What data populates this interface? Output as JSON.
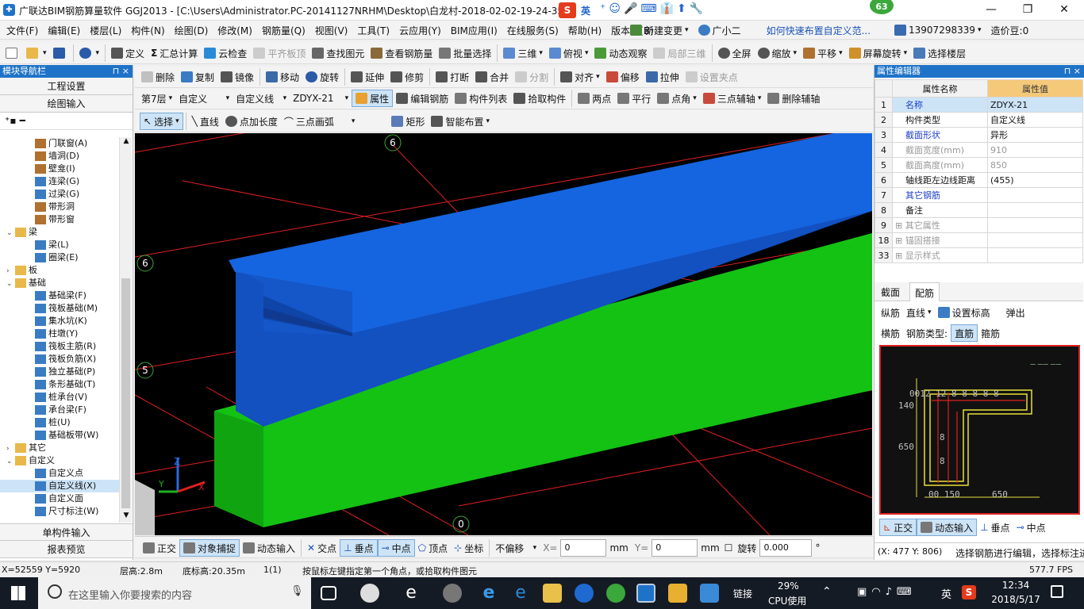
{
  "window": {
    "title": "广联达BIM钢筋算量软件 GGJ2013 - [C:\\Users\\Administrator.PC-20141127NRHM\\Desktop\\白龙村-2018-02-02-19-24-35",
    "badge": "63",
    "ime_lang": "英",
    "minimize": "—",
    "restore": "❐",
    "close": "✕"
  },
  "menu": {
    "items": [
      "文件(F)",
      "编辑(E)",
      "楼层(L)",
      "构件(N)",
      "绘图(D)",
      "修改(M)",
      "钢筋量(Q)",
      "视图(V)",
      "工具(T)",
      "云应用(Y)",
      "BIM应用(I)",
      "在线服务(S)",
      "帮助(H)",
      "版本号(B)"
    ],
    "new_change": "新建变更",
    "assistant": "广小二",
    "help_link": "如何快速布置自定义范...",
    "phone": "13907298339",
    "price": "造价豆:0"
  },
  "toolbar1": {
    "define": "定义",
    "sum_calc": "汇总计算",
    "cloud_check": "云检查",
    "level_top": "平齐板顶",
    "find": "查找图元",
    "view_rebar": "查看钢筋量",
    "batch_select": "批量选择",
    "view3d": "三维",
    "top_view": "俯视",
    "dynamic": "动态观察",
    "local3d": "局部三维",
    "fullscreen": "全屏",
    "zoom": "缩放",
    "pan": "平移",
    "rotate_screen": "屏幕旋转",
    "select_floor": "选择楼层"
  },
  "toolbar2": {
    "delete": "删除",
    "copy": "复制",
    "mirror": "镜像",
    "move": "移动",
    "rotate": "旋转",
    "extend": "延伸",
    "trim": "修剪",
    "break": "打断",
    "merge": "合并",
    "split": "分割",
    "align": "对齐",
    "offset": "偏移",
    "stretch": "拉伸",
    "set_pin": "设置夹点"
  },
  "toolbar3": {
    "floor": "第7层",
    "type": "自定义",
    "subtype": "自定义线",
    "name": "ZDYX-21",
    "properties": "属性",
    "edit_rebar": "编辑钢筋",
    "comp_list": "构件列表",
    "pick": "拾取构件",
    "two_point": "两点",
    "parallel": "平行",
    "point_angle": "点角",
    "three_point_aux": "三点辅轴",
    "delete_aux": "删除辅轴"
  },
  "toolbar4": {
    "select": "选择",
    "line": "直线",
    "point_len": "点加长度",
    "arc": "三点画弧",
    "rect": "矩形",
    "smart": "智能布置"
  },
  "nav": {
    "title": "模块导航栏",
    "pin": "⊓ ×",
    "project": "工程设置",
    "draw_input": "绘图输入",
    "single_input": "单构件输入",
    "report": "报表预览",
    "tree": [
      {
        "t": "门联窗(A)",
        "lvl": 2,
        "c": "#b07030"
      },
      {
        "t": "墙洞(D)",
        "lvl": 2,
        "c": "#b07030"
      },
      {
        "t": "壁龛(I)",
        "lvl": 2,
        "c": "#b07030"
      },
      {
        "t": "连梁(G)",
        "lvl": 2,
        "c": "#3a7cc4"
      },
      {
        "t": "过梁(G)",
        "lvl": 2,
        "c": "#3a7cc4"
      },
      {
        "t": "带形洞",
        "lvl": 2,
        "c": "#b07030"
      },
      {
        "t": "带形窗",
        "lvl": 2,
        "c": "#b07030"
      },
      {
        "t": "梁",
        "lvl": 1,
        "c": "#e8b84a",
        "tog": "⌄"
      },
      {
        "t": "梁(L)",
        "lvl": 2,
        "c": "#3a7cc4"
      },
      {
        "t": "圈梁(E)",
        "lvl": 2,
        "c": "#3a7cc4"
      },
      {
        "t": "板",
        "lvl": 1,
        "c": "#e8b84a",
        "tog": "›"
      },
      {
        "t": "基础",
        "lvl": 1,
        "c": "#e8b84a",
        "tog": "⌄"
      },
      {
        "t": "基础梁(F)",
        "lvl": 2,
        "c": "#3a7cc4"
      },
      {
        "t": "筏板基础(M)",
        "lvl": 2,
        "c": "#3a7cc4"
      },
      {
        "t": "集水坑(K)",
        "lvl": 2,
        "c": "#3a7cc4"
      },
      {
        "t": "柱墩(Y)",
        "lvl": 2,
        "c": "#3a7cc4"
      },
      {
        "t": "筏板主筋(R)",
        "lvl": 2,
        "c": "#3a7cc4"
      },
      {
        "t": "筏板负筋(X)",
        "lvl": 2,
        "c": "#3a7cc4"
      },
      {
        "t": "独立基础(P)",
        "lvl": 2,
        "c": "#3a7cc4"
      },
      {
        "t": "条形基础(T)",
        "lvl": 2,
        "c": "#3a7cc4"
      },
      {
        "t": "桩承台(V)",
        "lvl": 2,
        "c": "#3a7cc4"
      },
      {
        "t": "承台梁(F)",
        "lvl": 2,
        "c": "#3a7cc4"
      },
      {
        "t": "桩(U)",
        "lvl": 2,
        "c": "#3a7cc4"
      },
      {
        "t": "基础板带(W)",
        "lvl": 2,
        "c": "#3a7cc4"
      },
      {
        "t": "其它",
        "lvl": 1,
        "c": "#e8b84a",
        "tog": "›"
      },
      {
        "t": "自定义",
        "lvl": 1,
        "c": "#e8b84a",
        "tog": "⌄"
      },
      {
        "t": "自定义点",
        "lvl": 2,
        "c": "#3a7cc4"
      },
      {
        "t": "自定义线(X)",
        "lvl": 2,
        "c": "#3a7cc4",
        "sel": true
      },
      {
        "t": "自定义面",
        "lvl": 2,
        "c": "#3a7cc4"
      },
      {
        "t": "尺寸标注(W)",
        "lvl": 2,
        "c": "#3a7cc4"
      }
    ]
  },
  "viewport": {
    "axis_labels": [
      "6",
      "6",
      "5",
      "0"
    ],
    "coord_z": "Z",
    "coord_y": "Y",
    "coord_x": "X"
  },
  "snapbar": {
    "ortho": "正交",
    "obj_snap": "对象捕捉",
    "dyn_input": "动态输入",
    "intersect": "交点",
    "perp": "垂点",
    "mid": "中点",
    "vertex": "顶点",
    "coord": "坐标",
    "offset": "不偏移",
    "x_label": "X=",
    "x_val": "0",
    "mm1": "mm",
    "y_label": "Y=",
    "y_val": "0",
    "mm2": "mm",
    "rotate_label": "旋转",
    "rotate_val": "0.000",
    "deg": "°"
  },
  "props": {
    "title": "属性编辑器",
    "col_name": "属性名称",
    "col_val": "属性值",
    "rows": [
      {
        "n": "1",
        "k": "名称",
        "v": "ZDYX-21",
        "kc": "blue"
      },
      {
        "n": "2",
        "k": "构件类型",
        "v": "自定义线",
        "kc": ""
      },
      {
        "n": "3",
        "k": "截面形状",
        "v": "异形",
        "kc": "blue"
      },
      {
        "n": "4",
        "k": "截面宽度(mm)",
        "v": "910",
        "kc": "greyt"
      },
      {
        "n": "5",
        "k": "截面高度(mm)",
        "v": "850",
        "kc": "greyt"
      },
      {
        "n": "6",
        "k": "轴线距左边线距离",
        "v": "(455)",
        "kc": ""
      },
      {
        "n": "7",
        "k": "其它钢筋",
        "v": "",
        "kc": "blue"
      },
      {
        "n": "8",
        "k": "备注",
        "v": "",
        "kc": ""
      },
      {
        "n": "9",
        "k": "其它属性",
        "v": "",
        "kc": "greyt",
        "exp": "+"
      },
      {
        "n": "18",
        "k": "锚固搭接",
        "v": "",
        "kc": "greyt",
        "exp": "+"
      },
      {
        "n": "33",
        "k": "显示样式",
        "v": "",
        "kc": "greyt",
        "exp": "+"
      }
    ],
    "tab_section": "截面",
    "tab_rebar": "配筋",
    "long_rebar": "纵筋",
    "line": "直线",
    "set_mark": "设置标高",
    "popup": "弹出",
    "horiz_rebar": "横筋",
    "rebar_type": "钢筋类型:",
    "straight": "直筋",
    "stirrup": "箍筋",
    "sec_labels": {
      "top": "0012 12 8 8 8 8 8",
      "l1": "140",
      "l2": "650",
      "b1": "00 150",
      "b2": "650",
      "c1": "8",
      "c2": "8"
    },
    "ortho": "正交",
    "dyn_input": "动态输入",
    "perp": "垂点",
    "mid": "中点",
    "coord": "(X: 477 Y: 806)",
    "hint": "选择钢筋进行编辑，选择标注进"
  },
  "status": {
    "xy": "X=52559 Y=5920",
    "floor_h": "层高:2.8m",
    "bottom_h": "底标高:20.35m",
    "count": "1(1)",
    "hint": "按鼠标左键指定第一个角点，或拾取构件图元",
    "fps": "577.7 FPS"
  },
  "taskbar": {
    "search": "在这里输入你要搜索的内容",
    "cpu_pct": "29%",
    "cpu_label": "CPU使用",
    "link": "链接",
    "lang": "英",
    "time": "12:34",
    "date": "2018/5/17"
  },
  "colors": {
    "beam_top": "#1565e0",
    "beam_web": "#1350c0",
    "beam_green": "#14c214",
    "accent": "#1e73c8"
  }
}
